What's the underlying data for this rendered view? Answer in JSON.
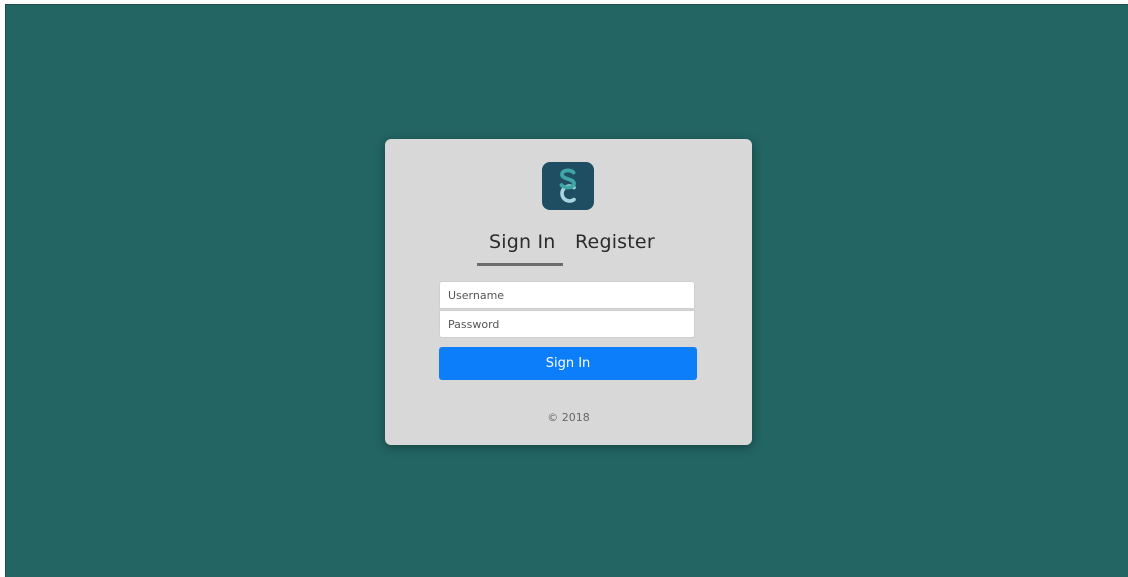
{
  "login": {
    "logo_alt": "SC",
    "tabs": {
      "signin_label": "Sign In",
      "register_label": "Register"
    },
    "username": {
      "placeholder": "Username",
      "value": ""
    },
    "password": {
      "placeholder": "Password",
      "value": ""
    },
    "submit_label": "Sign In",
    "footer": "© 2018"
  },
  "colors": {
    "background": "#226563",
    "card": "#d8d8d8",
    "logo_bg": "#1f4e63",
    "logo_s": "#3fa6a6",
    "logo_c": "#a9d4e0",
    "primary_button": "#0d7ef9",
    "active_tab_underline": "#6c6c6c"
  },
  "icons": [
    "sc-logo-icon"
  ]
}
